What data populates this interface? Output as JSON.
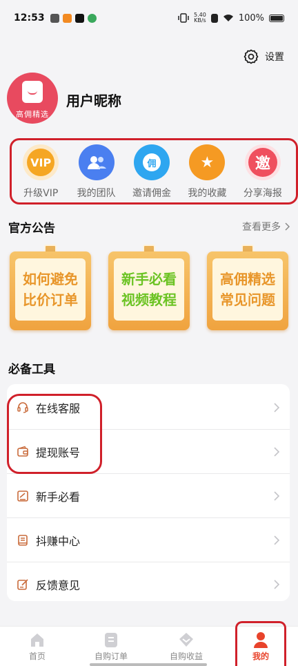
{
  "status_bar": {
    "time": "12:53",
    "net_speed_top": "5.40",
    "net_speed_bottom": "KB/s",
    "battery": "100%"
  },
  "header": {
    "settings_label": "设置"
  },
  "profile": {
    "brand_text": "高佣精选",
    "nickname": "用户昵称"
  },
  "quick_actions": [
    {
      "label": "升级VIP",
      "icon_text": "VIP",
      "icon": "vip-icon",
      "color": "#f5a623"
    },
    {
      "label": "我的团队",
      "icon_text": "",
      "icon": "team-icon",
      "color": "#4a7ff0"
    },
    {
      "label": "邀请佣金",
      "icon_text": "佣",
      "icon": "money-bag-icon",
      "color": "#2ea6f0"
    },
    {
      "label": "我的收藏",
      "icon_text": "",
      "icon": "star-icon",
      "color": "#f59a23"
    },
    {
      "label": "分享海报",
      "icon_text": "邀",
      "icon": "invite-icon",
      "color": "#ef4f5e"
    }
  ],
  "notices_section": {
    "title": "官方公告",
    "more_label": "查看更多",
    "items": [
      {
        "line1": "如何避免",
        "line2": "比价订单",
        "color": "#e8962a"
      },
      {
        "line1": "新手必看",
        "line2": "视频教程",
        "color": "#6bc323"
      },
      {
        "line1": "高佣精选",
        "line2": "常见问题",
        "color": "#e8962a"
      }
    ]
  },
  "tools_section": {
    "title": "必备工具",
    "items": [
      {
        "label": "在线客服",
        "icon": "headset-icon"
      },
      {
        "label": "提现账号",
        "icon": "wallet-icon"
      },
      {
        "label": "新手必看",
        "icon": "guide-icon"
      },
      {
        "label": "抖赚中心",
        "icon": "book-icon"
      },
      {
        "label": "反馈意见",
        "icon": "feedback-icon"
      }
    ]
  },
  "bottom_nav": [
    {
      "label": "首页",
      "icon": "home-icon",
      "active": false
    },
    {
      "label": "自购订单",
      "icon": "order-icon",
      "active": false
    },
    {
      "label": "自购收益",
      "icon": "earnings-icon",
      "active": false
    },
    {
      "label": "我的",
      "icon": "profile-icon",
      "active": true
    }
  ],
  "colors": {
    "accent": "#e8432b",
    "highlight_frame": "#d0202a",
    "tool_icon": "#c96a3a"
  }
}
